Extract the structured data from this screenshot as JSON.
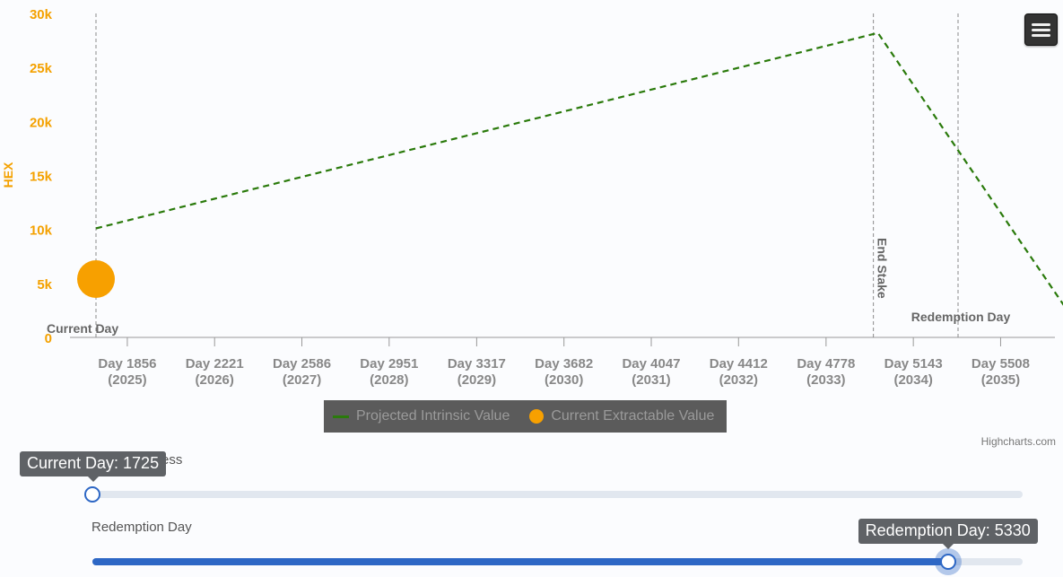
{
  "chart_data": {
    "type": "line",
    "ylabel": "HEX",
    "ylim": [
      0,
      30000
    ],
    "yticks": [
      "0",
      "5k",
      "10k",
      "15k",
      "20k",
      "25k",
      "30k"
    ],
    "xlim": [
      1725,
      5900
    ],
    "xticks": [
      {
        "day": 1856,
        "label": "Day 1856",
        "sub": "(2025)"
      },
      {
        "day": 2221,
        "label": "Day 2221",
        "sub": "(2026)"
      },
      {
        "day": 2586,
        "label": "Day 2586",
        "sub": "(2027)"
      },
      {
        "day": 2951,
        "label": "Day 2951",
        "sub": "(2028)"
      },
      {
        "day": 3317,
        "label": "Day 3317",
        "sub": "(2029)"
      },
      {
        "day": 3682,
        "label": "Day 3682",
        "sub": "(2030)"
      },
      {
        "day": 4047,
        "label": "Day 4047",
        "sub": "(2031)"
      },
      {
        "day": 4412,
        "label": "Day 4412",
        "sub": "(2032)"
      },
      {
        "day": 4778,
        "label": "Day 4778",
        "sub": "(2033)"
      },
      {
        "day": 5143,
        "label": "Day 5143",
        "sub": "(2034)"
      },
      {
        "day": 5508,
        "label": "Day 5508",
        "sub": "(2035)"
      }
    ],
    "plot_lines": [
      {
        "day": 1725,
        "label": "Current Day",
        "orientation": "horizontal"
      },
      {
        "day": 4976,
        "label": "End Stake",
        "orientation": "vertical"
      },
      {
        "day": 5330,
        "label": "Redemption Day",
        "orientation": "horizontal"
      }
    ],
    "series": [
      {
        "name": "Projected Intrinsic Value",
        "kind": "line",
        "style": "dashed",
        "color": "#2a7a0b",
        "points": [
          [
            1725,
            10100
          ],
          [
            4995,
            28200
          ],
          [
            5864,
            0
          ]
        ]
      },
      {
        "name": "Current Extractable Value",
        "kind": "scatter",
        "color": "#f7a000",
        "points": [
          [
            1725,
            5400
          ]
        ]
      }
    ],
    "credits": "Highcharts.com"
  },
  "sliders": [
    {
      "label": "ess",
      "tooltip": "Current Day: 1725",
      "value": 1725,
      "min": 1725,
      "max": 5645
    },
    {
      "label": "Redemption Day",
      "tooltip": "Redemption Day: 5330",
      "value": 5330,
      "min": 1725,
      "max": 5645
    }
  ],
  "colors": {
    "axis_label": "#f4a100",
    "tick_label": "#888888",
    "plot_line": "#8a8a8a",
    "slider_fill": "#2d67c5",
    "slider_track": "#e1e7ef"
  },
  "icons": {
    "menu": "hamburger-icon"
  }
}
